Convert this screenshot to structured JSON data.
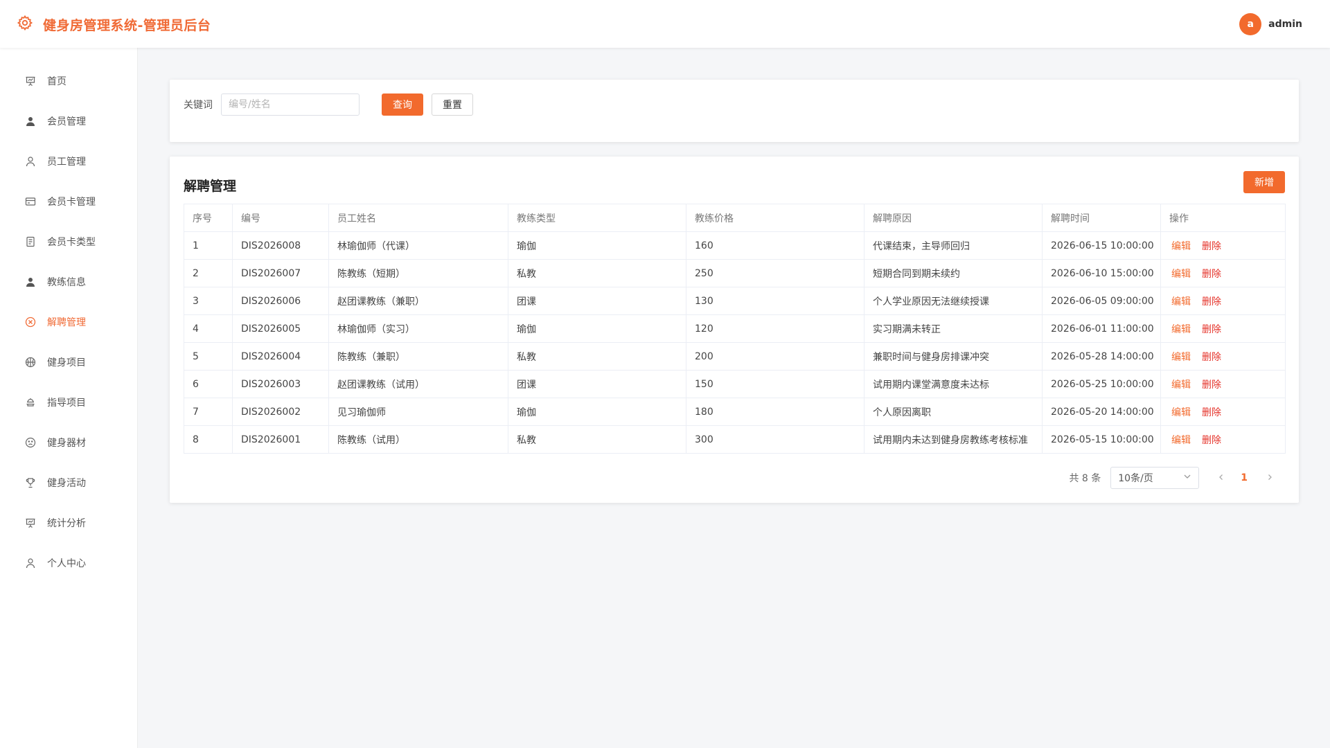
{
  "header": {
    "title": "健身房管理系统-管理员后台",
    "avatar_letter": "a",
    "username": "admin"
  },
  "sidebar": {
    "items": [
      {
        "label": "首页",
        "icon": "presentation-board-icon"
      },
      {
        "label": "会员管理",
        "icon": "user-filled-icon"
      },
      {
        "label": "员工管理",
        "icon": "user-outline-icon"
      },
      {
        "label": "会员卡管理",
        "icon": "credit-card-icon"
      },
      {
        "label": "会员卡类型",
        "icon": "document-icon"
      },
      {
        "label": "教练信息",
        "icon": "user-filled-icon"
      },
      {
        "label": "解聘管理",
        "icon": "circle-close-icon",
        "active": true
      },
      {
        "label": "健身项目",
        "icon": "basketball-icon"
      },
      {
        "label": "指导项目",
        "icon": "food-icon"
      },
      {
        "label": "健身器材",
        "icon": "face-icon"
      },
      {
        "label": "健身活动",
        "icon": "trophy-icon"
      },
      {
        "label": "统计分析",
        "icon": "presentation-board-icon"
      },
      {
        "label": "个人中心",
        "icon": "user-outline-icon"
      }
    ]
  },
  "search": {
    "label": "关键词",
    "placeholder": "编号/姓名",
    "query_label": "查询",
    "reset_label": "重置"
  },
  "table": {
    "title": "解聘管理",
    "add_label": "新增",
    "columns": [
      "序号",
      "编号",
      "员工姓名",
      "教练类型",
      "教练价格",
      "解聘原因",
      "解聘时间",
      "操作"
    ],
    "edit_label": "编辑",
    "delete_label": "删除",
    "rows": [
      {
        "index": "1",
        "code": "DIS2026008",
        "name": "林瑜伽师（代课）",
        "type": "瑜伽",
        "price": "160",
        "reason": "代课结束，主导师回归",
        "time": "2026-06-15 10:00:00"
      },
      {
        "index": "2",
        "code": "DIS2026007",
        "name": "陈教练（短期）",
        "type": "私教",
        "price": "250",
        "reason": "短期合同到期未续约",
        "time": "2026-06-10 15:00:00"
      },
      {
        "index": "3",
        "code": "DIS2026006",
        "name": "赵团课教练（兼职）",
        "type": "团课",
        "price": "130",
        "reason": "个人学业原因无法继续授课",
        "time": "2026-06-05 09:00:00"
      },
      {
        "index": "4",
        "code": "DIS2026005",
        "name": "林瑜伽师（实习）",
        "type": "瑜伽",
        "price": "120",
        "reason": "实习期满未转正",
        "time": "2026-06-01 11:00:00"
      },
      {
        "index": "5",
        "code": "DIS2026004",
        "name": "陈教练（兼职）",
        "type": "私教",
        "price": "200",
        "reason": "兼职时间与健身房排课冲突",
        "time": "2026-05-28 14:00:00"
      },
      {
        "index": "6",
        "code": "DIS2026003",
        "name": "赵团课教练（试用）",
        "type": "团课",
        "price": "150",
        "reason": "试用期内课堂满意度未达标",
        "time": "2026-05-25 10:00:00"
      },
      {
        "index": "7",
        "code": "DIS2026002",
        "name": "见习瑜伽师",
        "type": "瑜伽",
        "price": "180",
        "reason": "个人原因离职",
        "time": "2026-05-20 14:00:00"
      },
      {
        "index": "8",
        "code": "DIS2026001",
        "name": "陈教练（试用）",
        "type": "私教",
        "price": "300",
        "reason": "试用期内未达到健身房教练考核标准",
        "time": "2026-05-15 10:00:00"
      }
    ]
  },
  "pagination": {
    "total_text": "共 8 条",
    "page_size": "10条/页",
    "current_page": "1"
  },
  "colors": {
    "accent": "#f26a2d",
    "danger": "#e5342b"
  }
}
